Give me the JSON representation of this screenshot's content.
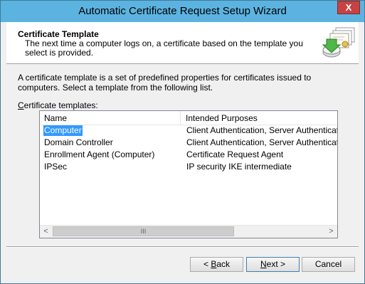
{
  "window": {
    "title": "Automatic Certificate Request Setup Wizard",
    "close_glyph": "X"
  },
  "header": {
    "title": "Certificate Template",
    "description": "The next time a computer logs on, a certificate based on the template you select is provided."
  },
  "intro": "A certificate template is a set of predefined properties for certificates issued to computers. Select a template from the following list.",
  "list": {
    "label_accel": "C",
    "label_rest": "ertificate templates:",
    "columns": [
      "Name",
      "Intended Purposes"
    ],
    "rows": [
      {
        "name": "Computer",
        "purposes": "Client Authentication, Server Authentication",
        "selected": true
      },
      {
        "name": "Domain Controller",
        "purposes": "Client Authentication, Server Authentication",
        "selected": false
      },
      {
        "name": "Enrollment Agent (Computer)",
        "purposes": "Certificate Request Agent",
        "selected": false
      },
      {
        "name": "IPSec",
        "purposes": "IP security IKE intermediate",
        "selected": false
      }
    ],
    "scroll_left": "<",
    "scroll_right": ">",
    "thumb_grip": "III"
  },
  "buttons": {
    "back_prefix": "< ",
    "back_accel": "B",
    "back_rest": "ack",
    "next_accel": "N",
    "next_rest": "ext >",
    "cancel": "Cancel"
  },
  "icons": {
    "wizard": "certificate-stack-icon"
  }
}
